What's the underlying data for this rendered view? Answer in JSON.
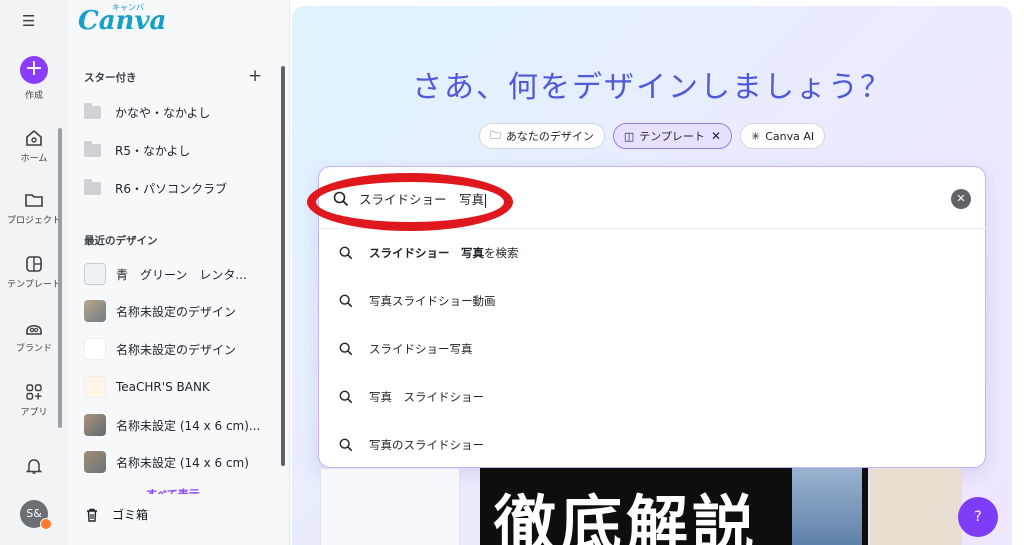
{
  "rail": {
    "create_label": "作成",
    "home_label": "ホーム",
    "projects_label": "プロジェクト",
    "templates_label": "テンプレート",
    "brand_label": "ブランド",
    "apps_label": "アプリ",
    "avatar_initials": "S&"
  },
  "sidebar": {
    "logo": "Canva",
    "logo_kana": "キャンバ",
    "starred_title": "スター付き",
    "starred": [
      {
        "label": "かなや・なかよし"
      },
      {
        "label": "R5・なかよし"
      },
      {
        "label": "R6・パソコンクラブ"
      }
    ],
    "recent_title": "最近のデザイン",
    "recent": [
      {
        "label": "青　グリーン　レンタ..."
      },
      {
        "label": "名称未設定のデザイン"
      },
      {
        "label": "名称未設定のデザイン"
      },
      {
        "label": "TeaCHR'S BANK"
      },
      {
        "label": "名称未設定 (14 x 6 cm)..."
      },
      {
        "label": "名称未設定 (14 x 6 cm)"
      }
    ],
    "more_label": "すべて表示",
    "trash_label": "ゴミ箱"
  },
  "main": {
    "hero": "さあ、何をデザインしましょう？",
    "chips": [
      {
        "label": "あなたのデザイン"
      },
      {
        "label": "テンプレート"
      },
      {
        "label": "Canva AI"
      }
    ],
    "search_value": "スライドショー　写真",
    "suggestions": [
      {
        "bold": "スライドショー　写真",
        "rest": "を検索"
      },
      {
        "bold": "",
        "rest": "写真スライドショー動画"
      },
      {
        "bold": "",
        "rest": "スライドショー写真"
      },
      {
        "bold": "",
        "rest": "写真　スライドショー"
      },
      {
        "bold": "",
        "rest": "写真のスライドショー"
      }
    ],
    "preview_text": "徹底解説",
    "help_label": "?"
  },
  "colors": {
    "accent": "#8b3dff",
    "hero": "#4f59d9",
    "annotation_ring": "#e0171c"
  }
}
